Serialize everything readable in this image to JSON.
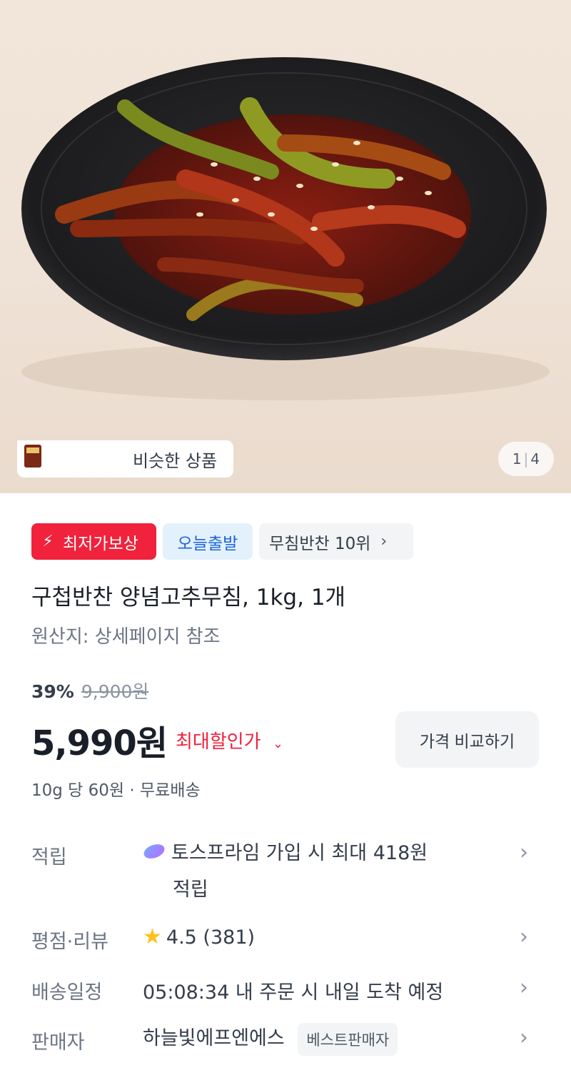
{
  "colors": {
    "accent_red": "#f0223c",
    "accent_blue": "#1b64da",
    "star_yellow": "#ffc21a"
  },
  "gallery": {
    "similar_label": "비슷한 상품",
    "current_index": "1",
    "total_count": "4"
  },
  "badges": {
    "lowest_price": "최저가보상",
    "ship_today": "오늘출발",
    "category_rank": "무침반찬 10위"
  },
  "product": {
    "title": "구첩반찬 양념고추무침, 1kg, 1개",
    "origin": "원산지: 상세페이지 참조",
    "discount_rate": "39%",
    "original_price": "9,900원",
    "price": "5,990원",
    "max_discount_label": "최대할인가",
    "compare_button": "가격 비교하기",
    "unit_price_shipping": "10g 당 60원 · 무료배송"
  },
  "info": {
    "points_label": "적립",
    "points_value_line1": "토스프라임 가입 시 최대 418원",
    "points_value_line2": "적립",
    "rating_label": "평점·리뷰",
    "rating_value": "4.5 (381)",
    "delivery_label": "배송일정",
    "delivery_value": "05:08:34 내 주문 시 내일 도착 예정",
    "seller_label": "판매자",
    "seller_name": "하늘빛에프엔에스",
    "seller_badge": "베스트판매자"
  }
}
